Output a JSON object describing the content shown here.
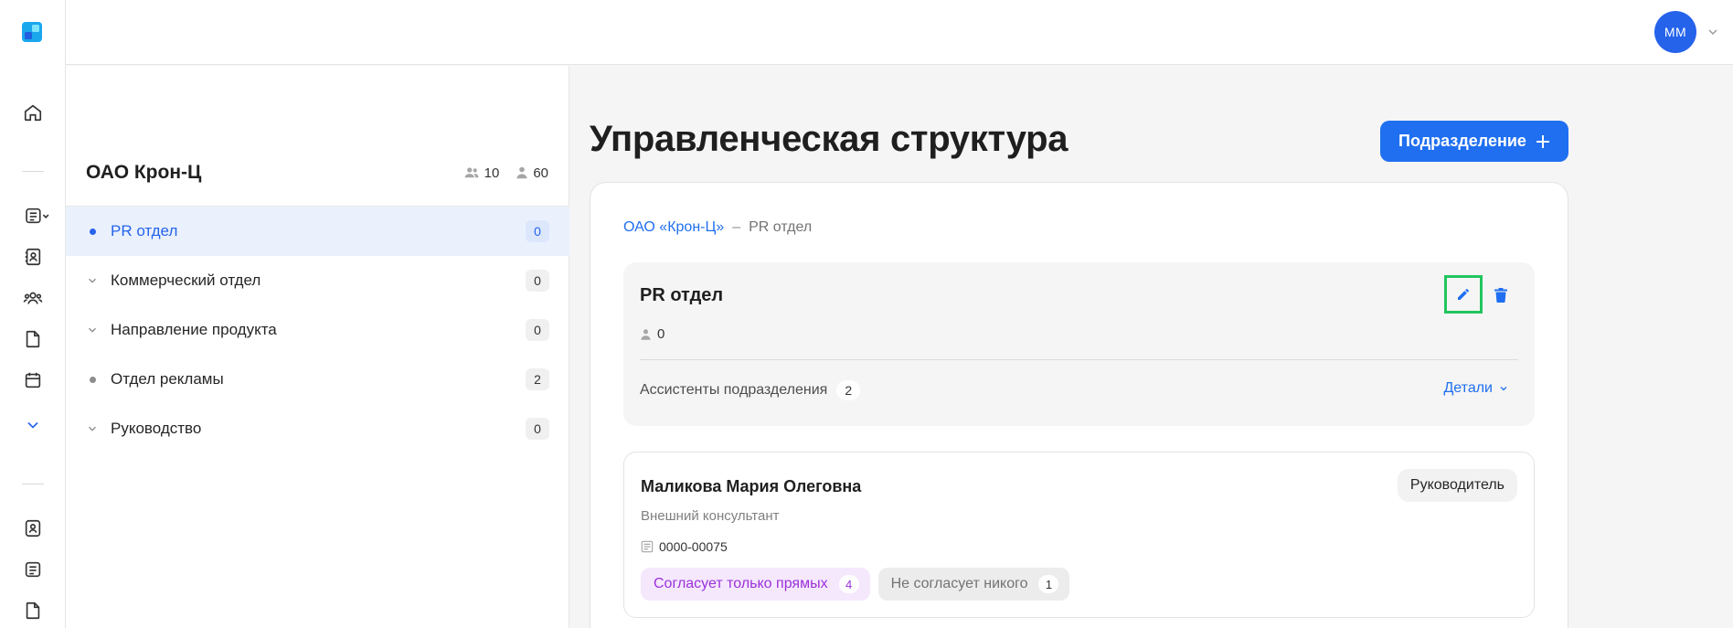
{
  "header": {
    "avatar_initials": "MM"
  },
  "rail": {
    "icons": [
      "logo-icon",
      "home-icon",
      "documents-dropdown-icon",
      "contacts-icon",
      "users-icon",
      "file-icon",
      "calendar-icon",
      "chevron-down-icon",
      "profile-icon",
      "list-icon",
      "file-icon"
    ],
    "accent": "#2563eb"
  },
  "tree": {
    "title": "ОАО Крон-Ц",
    "groups_count": "10",
    "people_count": "60",
    "items": [
      {
        "label": "PR отдел",
        "count": "0",
        "lead": "dot",
        "active": true
      },
      {
        "label": "Коммерческий отдел",
        "count": "0",
        "lead": "chevron"
      },
      {
        "label": "Направление продукта",
        "count": "0",
        "lead": "chevron"
      },
      {
        "label": "Отдел рекламы",
        "count": "2",
        "lead": "dot"
      },
      {
        "label": "Руководство",
        "count": "0",
        "lead": "chevron"
      }
    ]
  },
  "main": {
    "title": "Управленческая структура",
    "add_button_label": "Подразделение",
    "breadcrumb": {
      "root": "ОАО «Крон-Ц»",
      "separator": "–",
      "current": "PR отдел"
    },
    "department": {
      "name": "PR отдел",
      "people_count": "0",
      "assistants_label": "Ассистенты подразделения",
      "assistants_count": "2",
      "details_label": "Детали"
    },
    "person": {
      "name": "Маликова Мария Олеговна",
      "position": "Внешний консультант",
      "employee_id": "0000-00075",
      "role": "Руководитель",
      "tags": [
        {
          "label": "Согласует только прямых",
          "count": "4",
          "style": "purple"
        },
        {
          "label": "Не согласует никого",
          "count": "1",
          "style": "gray"
        }
      ]
    }
  },
  "colors": {
    "primary": "#1f6ff0",
    "highlight": "#22c55e",
    "purple_tag": "#9b30d9"
  }
}
